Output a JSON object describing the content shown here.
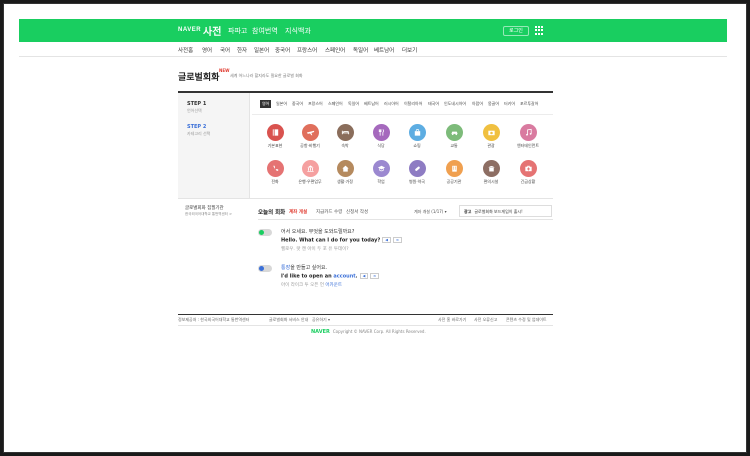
{
  "header": {
    "logo": "NAVER",
    "brand": "사전",
    "nav": [
      "파파고",
      "참여번역",
      "지식백과"
    ],
    "login": "로그인",
    "apps_icon": "grid-icon",
    "color": "#19ce60"
  },
  "subnav": [
    "사전홈",
    "영어",
    "국어",
    "한자",
    "일본어",
    "중국어",
    "프랑스어",
    "스페인어",
    "독일어",
    "베트남어",
    "더보기"
  ],
  "page": {
    "title": "글로벌회화",
    "badge": "NEW",
    "description": "세계 어느나라 할지라도 필요한 글로벌 회화"
  },
  "steps": [
    {
      "label": "STEP 1",
      "sub": "언어선택"
    },
    {
      "label": "STEP 2",
      "sub": "카테고리 선택"
    }
  ],
  "languages": [
    "영어",
    "일본어",
    "중국어",
    "프랑스어",
    "스페인어",
    "독일어",
    "베트남어",
    "러시아어",
    "이탈리아어",
    "태국어",
    "인도네시아어",
    "아랍어",
    "몽골어",
    "터키어",
    "포르투갈어"
  ],
  "categories": [
    {
      "label": "기본표현",
      "icon": "book-icon",
      "color": "#d9534f"
    },
    {
      "label": "공항·비행기",
      "icon": "plane-icon",
      "color": "#e06f5c"
    },
    {
      "label": "숙박",
      "icon": "hotel-icon",
      "color": "#8a6d5b"
    },
    {
      "label": "식당",
      "icon": "fork-icon",
      "color": "#a569bd"
    },
    {
      "label": "쇼핑",
      "icon": "shop-icon",
      "color": "#5dade2"
    },
    {
      "label": "교통",
      "icon": "car-icon",
      "color": "#7dbb7a"
    },
    {
      "label": "관광",
      "icon": "camera-icon",
      "color": "#f0c040"
    },
    {
      "label": "엔터테인먼트",
      "icon": "music-icon",
      "color": "#d97ba0"
    },
    {
      "label": "전화",
      "icon": "phone-icon",
      "color": "#e57373"
    },
    {
      "label": "은행·우편업무",
      "icon": "bank-icon",
      "color": "#f5a0a0"
    },
    {
      "label": "생활·가정",
      "icon": "home-icon",
      "color": "#b58a5e"
    },
    {
      "label": "학업",
      "icon": "school-icon",
      "color": "#9b88d0"
    },
    {
      "label": "병원·약국",
      "icon": "pill-icon",
      "color": "#8e7cc3"
    },
    {
      "label": "공공기관",
      "icon": "building-icon",
      "color": "#f0a050"
    },
    {
      "label": "편의시설",
      "icon": "store-icon",
      "color": "#8d6e63"
    },
    {
      "label": "긴급상황",
      "icon": "emergency-icon",
      "color": "#e57373"
    }
  ],
  "side": {
    "title": "글로벌회화 집필기관",
    "sub": "한국외국어대학교 통번역센터 >"
  },
  "today": {
    "label": "오늘의 회화",
    "tabs": [
      "계좌 개설",
      "지급카드 수령",
      "신청서 작성"
    ],
    "date": "계좌 개설 (1/17) ▾",
    "ad_tag": "광고",
    "ad_text": "글로벌회화 보드게임이 출시!"
  },
  "dialog": [
    {
      "ko": "어서 오세요. 무엇을 도와드릴까요?",
      "en": "Hello. What can I do for you today?",
      "read": "헬로우. 왓 캔 아이 두 포 유 투데이?"
    },
    {
      "ko_prefix": "",
      "ko_kw": "통장",
      "ko_rest": "을 만들고 싶어요.",
      "en_prefix": "I'd like to open an ",
      "en_kw": "account",
      "en_rest": ".",
      "read_prefix": "아이 라이크 투 오픈 언 ",
      "read_kw": "어카운트"
    }
  ],
  "footer": {
    "left": [
      "정보제공처 : 한국외국어대학교 통번역센터",
      "글로벌회화 서비스 안내",
      "공유하기 ▾"
    ],
    "right": [
      "사전 홈 바로가기",
      "사전 오류신고",
      "콘텐츠 수정 및 업데이트"
    ],
    "copyright_logo": "NAVER",
    "copyright": "Copyright © NAVER Corp. All Rights Reserved."
  }
}
